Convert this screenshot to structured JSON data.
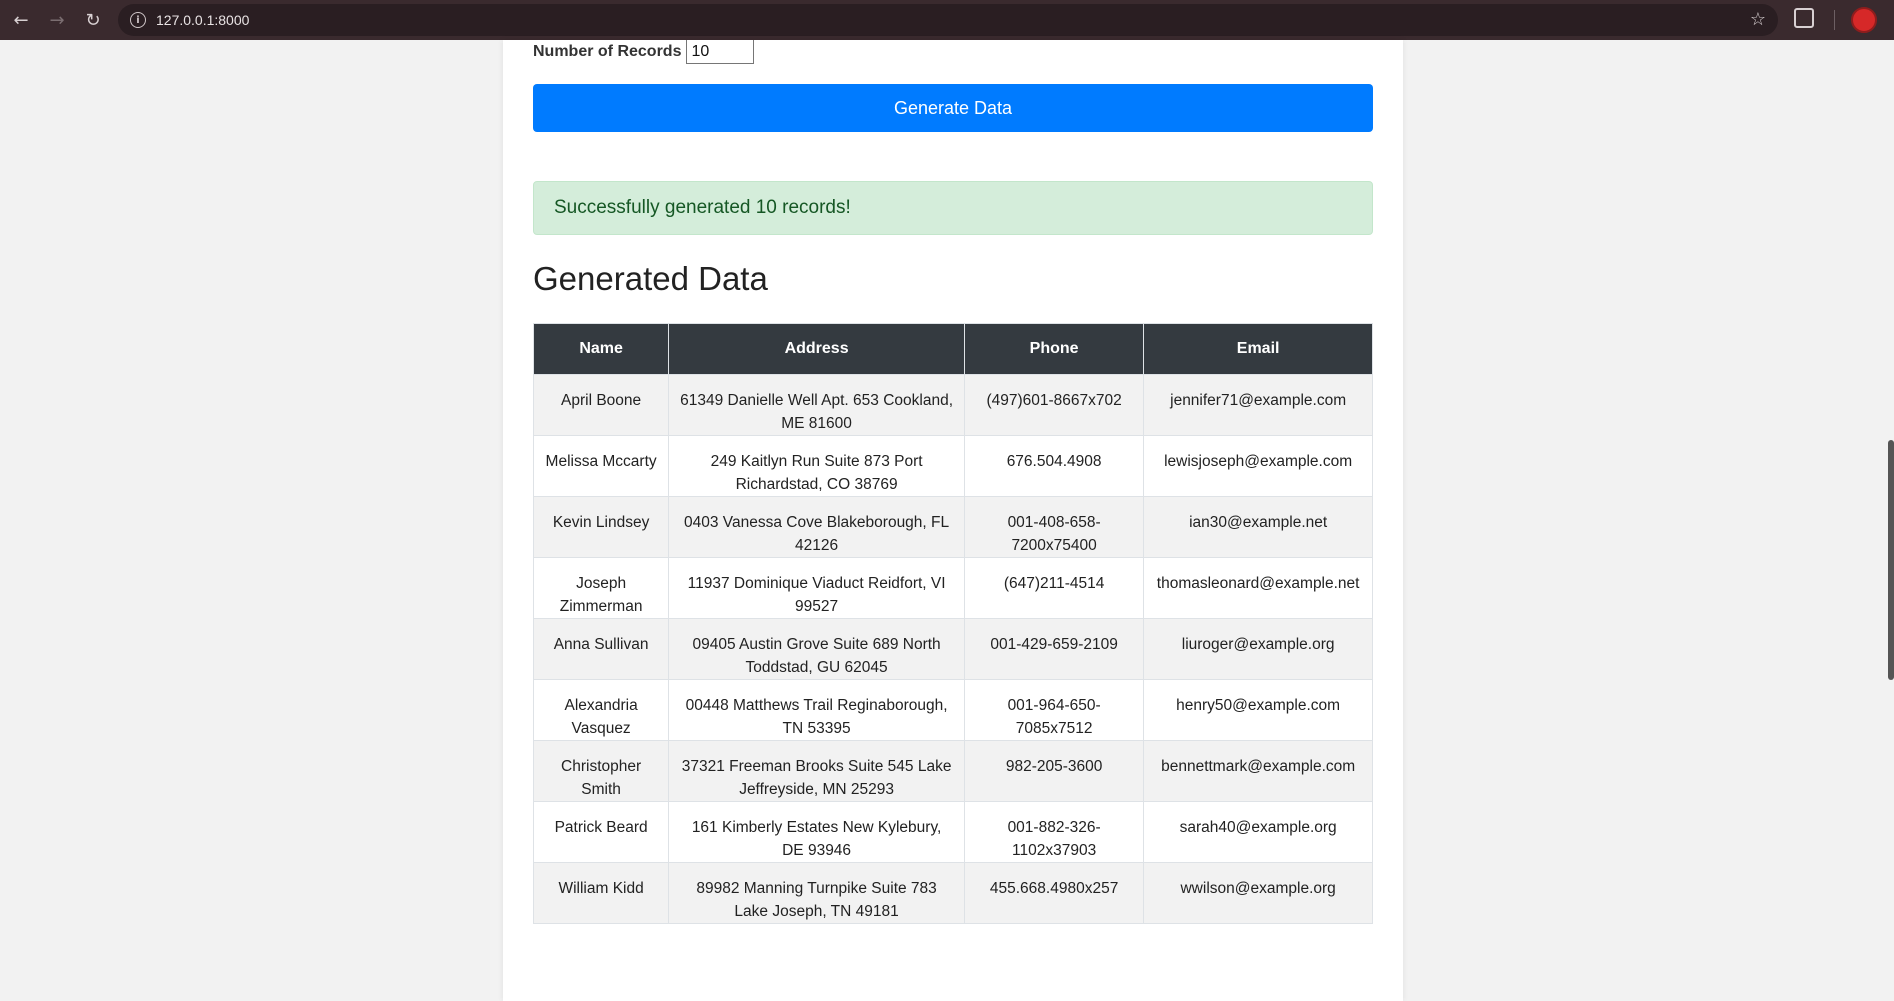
{
  "browser": {
    "url": "127.0.0.1:8000"
  },
  "form": {
    "records_label": "Number of Records",
    "records_value": "10",
    "generate_label": "Generate Data"
  },
  "alert": {
    "message": "Successfully generated 10 records!"
  },
  "section": {
    "title": "Generated Data"
  },
  "table": {
    "headers": [
      "Name",
      "Address",
      "Phone",
      "Email"
    ],
    "rows": [
      {
        "name": "April Boone",
        "address": "61349 Danielle Well Apt. 653 Cookland, ME 81600",
        "phone": "(497)601-8667x702",
        "email": "jennifer71@example.com"
      },
      {
        "name": "Melissa Mccarty",
        "address": "249 Kaitlyn Run Suite 873 Port Richardstad, CO 38769",
        "phone": "676.504.4908",
        "email": "lewisjoseph@example.com"
      },
      {
        "name": "Kevin Lindsey",
        "address": "0403 Vanessa Cove Blakeborough, FL 42126",
        "phone": "001-408-658-7200x75400",
        "email": "ian30@example.net"
      },
      {
        "name": "Joseph Zimmerman",
        "address": "11937 Dominique Viaduct Reidfort, VI 99527",
        "phone": "(647)211-4514",
        "email": "thomasleonard@example.net"
      },
      {
        "name": "Anna Sullivan",
        "address": "09405 Austin Grove Suite 689 North Toddstad, GU 62045",
        "phone": "001-429-659-2109",
        "email": "liuroger@example.org"
      },
      {
        "name": "Alexandria Vasquez",
        "address": "00448 Matthews Trail Reginaborough, TN 53395",
        "phone": "001-964-650-7085x7512",
        "email": "henry50@example.com"
      },
      {
        "name": "Christopher Smith",
        "address": "37321 Freeman Brooks Suite 545 Lake Jeffreyside, MN 25293",
        "phone": "982-205-3600",
        "email": "bennettmark@example.com"
      },
      {
        "name": "Patrick Beard",
        "address": "161 Kimberly Estates New Kylebury, DE 93946",
        "phone": "001-882-326-1102x37903",
        "email": "sarah40@example.org"
      },
      {
        "name": "William Kidd",
        "address": "89982 Manning Turnpike Suite 783 Lake Joseph, TN 49181",
        "phone": "455.668.4980x257",
        "email": "wwilson@example.org"
      }
    ]
  },
  "colors": {
    "primary_button": "#007bff",
    "alert_bg": "#d4edda",
    "alert_text": "#155724",
    "table_header_bg": "#343a40",
    "chrome_bg": "#3a2a2e"
  }
}
